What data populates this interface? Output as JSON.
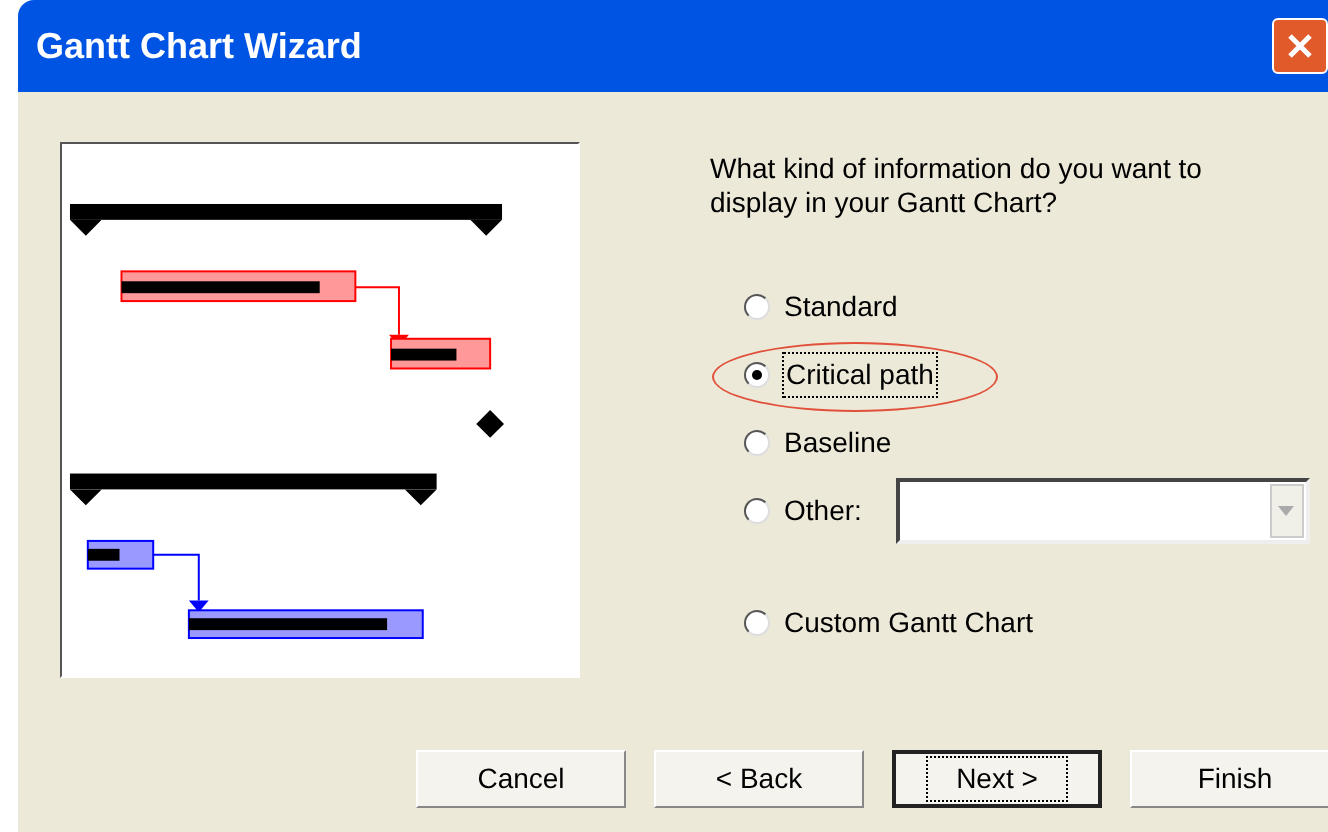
{
  "window": {
    "title": "Gantt Chart Wizard"
  },
  "question": "What kind of information do you want to display in your Gantt Chart?",
  "options": [
    {
      "label": "Standard",
      "selected": false,
      "kind": "plain",
      "highlighted": false
    },
    {
      "label": "Critical path",
      "selected": true,
      "kind": "plain",
      "highlighted": true
    },
    {
      "label": "Baseline",
      "selected": false,
      "kind": "plain",
      "highlighted": false
    },
    {
      "label": "Other:",
      "selected": false,
      "kind": "dropdown",
      "highlighted": false
    },
    {
      "label": "Custom Gantt Chart",
      "selected": false,
      "kind": "plain",
      "highlighted": false
    }
  ],
  "buttons": [
    {
      "label": "Cancel",
      "default": false
    },
    {
      "label": "< Back",
      "default": false
    },
    {
      "label": "Next >",
      "default": true
    },
    {
      "label": "Finish",
      "default": false
    }
  ]
}
